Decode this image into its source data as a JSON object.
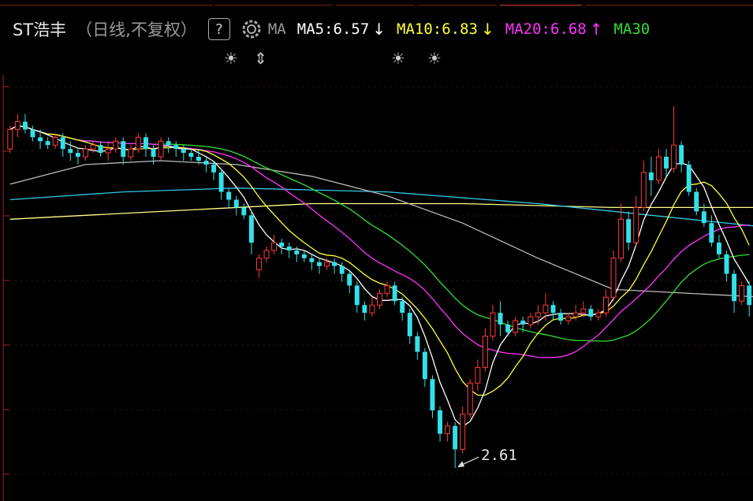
{
  "header": {
    "stock_name": "ST浩丰",
    "period": "（日线,不复权）",
    "help": "?",
    "ma_label": "MA",
    "ma": [
      {
        "label": "MA5:6.57",
        "arrow": "↓",
        "color": "#ffffff"
      },
      {
        "label": "MA10:6.83",
        "arrow": "↓",
        "color": "#ffff33"
      },
      {
        "label": "MA20:6.68",
        "arrow": "↑",
        "color": "#ff33ff"
      },
      {
        "label": "MA30",
        "arrow": "",
        "color": "#33dd33"
      }
    ]
  },
  "markers": [
    "☀",
    "⇕",
    "☀",
    "☀"
  ],
  "chart_data": {
    "type": "candlestick",
    "annotation": "2.61",
    "colors": {
      "up": "#ff3b3b",
      "down": "#33e0e8",
      "ma5": "#ffffff",
      "ma10": "#ffff33",
      "ma20": "#ff33ff",
      "ma30": "#33dd33",
      "ma60": "#bbbbbb",
      "ma120": "#33c8e8",
      "ma250": "#ffff88"
    },
    "candles": [
      [
        6.7,
        6.95,
        6.65,
        7.0
      ],
      [
        6.95,
        7.05,
        6.85,
        7.15
      ],
      [
        7.05,
        6.95,
        6.9,
        7.15
      ],
      [
        6.95,
        6.85,
        6.8,
        7.0
      ],
      [
        6.85,
        6.8,
        6.7,
        6.95
      ],
      [
        6.8,
        6.75,
        6.7,
        6.85
      ],
      [
        6.75,
        6.85,
        6.7,
        6.9
      ],
      [
        6.85,
        6.7,
        6.6,
        6.9
      ],
      [
        6.7,
        6.65,
        6.55,
        6.8
      ],
      [
        6.65,
        6.6,
        6.5,
        6.7
      ],
      [
        6.6,
        6.7,
        6.55,
        6.75
      ],
      [
        6.7,
        6.75,
        6.65,
        6.8
      ],
      [
        6.75,
        6.65,
        6.6,
        6.8
      ],
      [
        6.65,
        6.7,
        6.55,
        6.8
      ],
      [
        6.7,
        6.8,
        6.65,
        6.85
      ],
      [
        6.8,
        6.6,
        6.5,
        6.85
      ],
      [
        6.6,
        6.7,
        6.55,
        6.75
      ],
      [
        6.7,
        6.85,
        6.65,
        6.9
      ],
      [
        6.85,
        6.7,
        6.6,
        6.9
      ],
      [
        6.7,
        6.6,
        6.5,
        6.75
      ],
      [
        6.6,
        6.8,
        6.55,
        6.85
      ],
      [
        6.8,
        6.75,
        6.65,
        6.85
      ],
      [
        6.75,
        6.7,
        6.6,
        6.8
      ],
      [
        6.7,
        6.65,
        6.55,
        6.75
      ],
      [
        6.65,
        6.6,
        6.55,
        6.7
      ],
      [
        6.6,
        6.55,
        6.5,
        6.7
      ],
      [
        6.55,
        6.5,
        6.4,
        6.6
      ],
      [
        6.5,
        6.4,
        6.3,
        6.55
      ],
      [
        6.4,
        6.15,
        6.05,
        6.45
      ],
      [
        6.15,
        6.05,
        5.95,
        6.2
      ],
      [
        6.05,
        5.95,
        5.85,
        6.1
      ],
      [
        5.95,
        5.85,
        5.8,
        6.0
      ],
      [
        5.85,
        5.5,
        5.35,
        5.9
      ],
      [
        5.15,
        5.3,
        5.05,
        5.35
      ],
      [
        5.3,
        5.4,
        5.25,
        5.45
      ],
      [
        5.4,
        5.5,
        5.35,
        5.6
      ],
      [
        5.5,
        5.45,
        5.35,
        5.55
      ],
      [
        5.45,
        5.4,
        5.3,
        5.5
      ],
      [
        5.4,
        5.35,
        5.25,
        5.45
      ],
      [
        5.35,
        5.3,
        5.25,
        5.4
      ],
      [
        5.3,
        5.25,
        5.15,
        5.35
      ],
      [
        5.25,
        5.2,
        5.1,
        5.3
      ],
      [
        5.2,
        5.25,
        5.15,
        5.3
      ],
      [
        5.25,
        5.2,
        5.1,
        5.3
      ],
      [
        5.2,
        5.1,
        5.0,
        5.25
      ],
      [
        5.1,
        4.95,
        4.85,
        5.15
      ],
      [
        4.95,
        4.7,
        4.6,
        5.0
      ],
      [
        4.7,
        4.6,
        4.5,
        4.75
      ],
      [
        4.6,
        4.7,
        4.55,
        4.8
      ],
      [
        4.7,
        4.85,
        4.65,
        4.9
      ],
      [
        4.85,
        4.95,
        4.8,
        5.0
      ],
      [
        4.95,
        4.75,
        4.7,
        5.0
      ],
      [
        4.75,
        4.6,
        4.5,
        4.8
      ],
      [
        4.6,
        4.3,
        4.2,
        4.65
      ],
      [
        4.3,
        4.1,
        4.0,
        4.35
      ],
      [
        4.1,
        3.75,
        3.65,
        4.15
      ],
      [
        3.75,
        3.35,
        3.25,
        3.8
      ],
      [
        3.35,
        3.05,
        2.95,
        3.4
      ],
      [
        3.05,
        3.15,
        2.95,
        3.2
      ],
      [
        3.15,
        2.85,
        2.61,
        3.2
      ],
      [
        2.85,
        3.3,
        2.8,
        3.4
      ],
      [
        3.3,
        3.7,
        3.25,
        3.75
      ],
      [
        3.7,
        3.9,
        3.6,
        4.0
      ],
      [
        3.9,
        4.3,
        3.85,
        4.4
      ],
      [
        4.3,
        4.6,
        4.25,
        4.7
      ],
      [
        4.6,
        4.45,
        4.3,
        4.75
      ],
      [
        4.45,
        4.35,
        4.3,
        4.5
      ],
      [
        4.35,
        4.5,
        4.3,
        4.55
      ],
      [
        4.5,
        4.45,
        4.35,
        4.55
      ],
      [
        4.45,
        4.55,
        4.4,
        4.6
      ],
      [
        4.55,
        4.6,
        4.45,
        4.7
      ],
      [
        4.6,
        4.7,
        4.5,
        4.85
      ],
      [
        4.7,
        4.6,
        4.5,
        4.75
      ],
      [
        4.6,
        4.5,
        4.45,
        4.65
      ],
      [
        4.5,
        4.55,
        4.45,
        4.6
      ],
      [
        4.55,
        4.6,
        4.5,
        4.7
      ],
      [
        4.6,
        4.65,
        4.55,
        4.75
      ],
      [
        4.65,
        4.55,
        4.5,
        4.7
      ],
      [
        4.55,
        4.6,
        4.5,
        4.65
      ],
      [
        4.6,
        4.8,
        4.55,
        4.9
      ],
      [
        4.8,
        5.3,
        4.75,
        5.4
      ],
      [
        5.3,
        5.8,
        5.25,
        6.0
      ],
      [
        5.8,
        5.5,
        5.4,
        5.9
      ],
      [
        5.5,
        5.95,
        5.45,
        6.1
      ],
      [
        5.95,
        6.4,
        5.9,
        6.55
      ],
      [
        6.4,
        6.3,
        6.1,
        6.6
      ],
      [
        6.3,
        6.6,
        6.25,
        6.7
      ],
      [
        6.6,
        6.45,
        6.35,
        6.7
      ],
      [
        6.45,
        6.75,
        6.4,
        7.25
      ],
      [
        6.75,
        6.5,
        6.4,
        6.8
      ],
      [
        6.5,
        6.15,
        6.1,
        6.55
      ],
      [
        6.15,
        5.9,
        5.85,
        6.2
      ],
      [
        5.9,
        5.75,
        5.7,
        6.0
      ],
      [
        5.75,
        5.5,
        5.45,
        5.85
      ],
      [
        5.5,
        5.35,
        5.3,
        5.6
      ],
      [
        5.35,
        5.1,
        5.0,
        5.4
      ],
      [
        5.1,
        4.75,
        4.6,
        5.15
      ],
      [
        4.75,
        4.95,
        4.7,
        5.0
      ],
      [
        4.95,
        4.7,
        4.55,
        5.0
      ]
    ],
    "ma60": [
      [
        0,
        6.25
      ],
      [
        10,
        6.5
      ],
      [
        20,
        6.55
      ],
      [
        30,
        6.5
      ],
      [
        40,
        6.35
      ],
      [
        50,
        6.1
      ],
      [
        60,
        5.75
      ],
      [
        70,
        5.3
      ],
      [
        80,
        4.9
      ],
      [
        90,
        4.85
      ],
      [
        100,
        4.8
      ]
    ],
    "ma120": [
      [
        0,
        6.05
      ],
      [
        15,
        6.15
      ],
      [
        30,
        6.2
      ],
      [
        50,
        6.15
      ],
      [
        70,
        6.0
      ],
      [
        85,
        5.85
      ],
      [
        100,
        5.7
      ]
    ],
    "ma250": [
      [
        0,
        5.8
      ],
      [
        20,
        5.9
      ],
      [
        40,
        6.0
      ],
      [
        60,
        6.0
      ],
      [
        80,
        5.95
      ],
      [
        100,
        5.95
      ]
    ]
  }
}
